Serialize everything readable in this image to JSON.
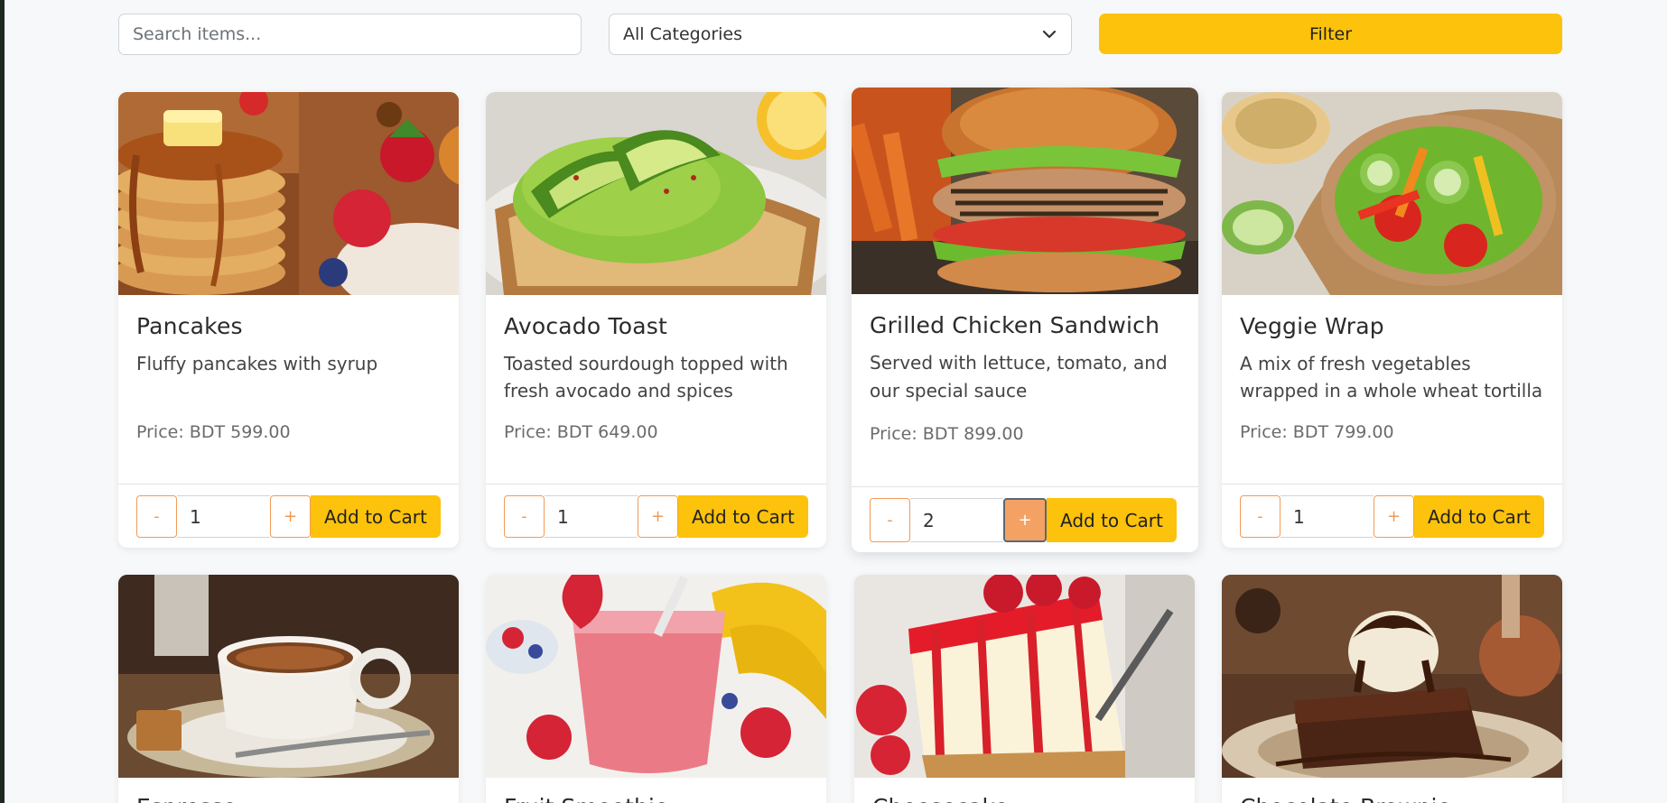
{
  "filters": {
    "search_placeholder": "Search items...",
    "category_selected": "All Categories",
    "filter_label": "Filter"
  },
  "cards": [
    {
      "title": "Pancakes",
      "description": "Fluffy pancakes with syrup",
      "price": "Price: BDT 599.00",
      "quantity": "1",
      "minus": "-",
      "plus": "+",
      "add_label": "Add to Cart"
    },
    {
      "title": "Avocado Toast",
      "description": "Toasted sourdough topped with fresh avocado and spices",
      "price": "Price: BDT 649.00",
      "quantity": "1",
      "minus": "-",
      "plus": "+",
      "add_label": "Add to Cart"
    },
    {
      "title": "Grilled Chicken Sandwich",
      "description": "Served with lettuce, tomato, and our special sauce",
      "price": "Price: BDT 899.00",
      "quantity": "2",
      "minus": "-",
      "plus": "+",
      "add_label": "Add to Cart"
    },
    {
      "title": "Veggie Wrap",
      "description": "A mix of fresh vegetables wrapped in a whole wheat tortilla",
      "price": "Price: BDT 799.00",
      "quantity": "1",
      "minus": "-",
      "plus": "+",
      "add_label": "Add to Cart"
    }
  ],
  "row2": [
    {
      "title": "Espresso"
    },
    {
      "title": "Fruit Smoothie"
    },
    {
      "title": "Cheesecake"
    },
    {
      "title": "Chocolate Brownie"
    }
  ],
  "colors": {
    "accent": "#fdc20b",
    "qty_border": "#f29a57"
  }
}
